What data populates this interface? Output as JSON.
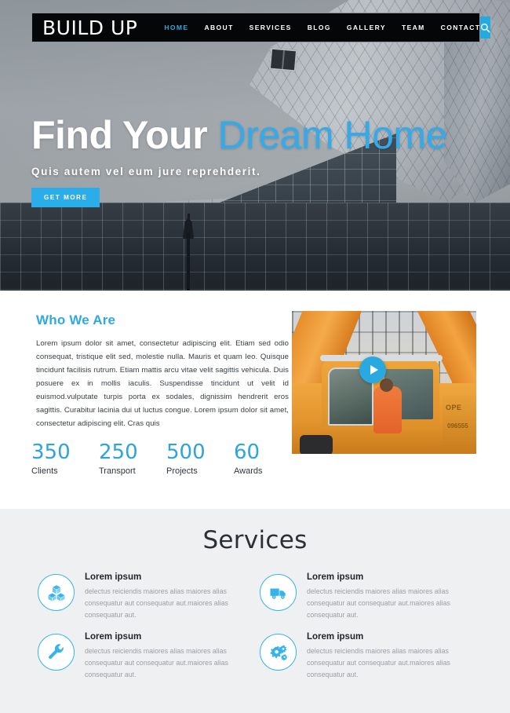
{
  "site": {
    "logo": "BUILD UP",
    "accent_color": "#2aa9e0",
    "nav_bg": "#050608"
  },
  "nav": {
    "items": [
      {
        "label": "HOME",
        "active": true
      },
      {
        "label": "ABOUT",
        "active": false
      },
      {
        "label": "SERVICES",
        "active": false
      },
      {
        "label": "BLOG",
        "active": false
      },
      {
        "label": "GALLERY",
        "active": false
      },
      {
        "label": "TEAM",
        "active": false
      },
      {
        "label": "CONTACT",
        "active": false
      }
    ],
    "search_icon": "search-icon"
  },
  "hero": {
    "title_plain": "Find Your ",
    "title_accent": "Dream Home",
    "subtitle": "Quis autem vel eum jure reprehderit.",
    "cta_label": "GET MORE",
    "background_description": "modern angular glass building with street lamp"
  },
  "about": {
    "heading": "Who We Are",
    "body": "Lorem ipsum dolor sit amet, consectetur adipiscing elit. Etiam sed odio consequat, tristique elit sed, molestie nulla. Mauris et quam leo. Quisque tincidunt facilisis rutrum. Etiam mattis arcu vitae velit sagittis vehicula. Duis posuere ex in mollis iaculis. Suspendisse tincidunt ut velit id euismod.vulputate turpis porta ex sodales, dignissim hendrerit eros sagittis. Curabitur lacinia dui ut luctus congue. Lorem ipsum dolor sit amet, consectetur adipiscing elit. Cras quis",
    "media": {
      "type": "video-thumbnail",
      "description": "yellow construction crane cab with operator",
      "play_icon": "play-icon",
      "overlay_text_1": "OPE",
      "overlay_text_2": "096555"
    },
    "stats": [
      {
        "value": "350",
        "label": "Clients"
      },
      {
        "value": "250",
        "label": "Transport"
      },
      {
        "value": "500",
        "label": "Projects"
      },
      {
        "value": "60",
        "label": "Awards"
      }
    ]
  },
  "services": {
    "heading": "Services",
    "items": [
      {
        "icon": "boxes-icon",
        "title": "Lorem ipsum",
        "desc": "delectus reiciendis maiores alias maiores alias consequatur aut consequatur aut.maiores alias consequatur aut."
      },
      {
        "icon": "truck-icon",
        "title": "Lorem ipsum",
        "desc": "delectus reiciendis maiores alias maiores alias consequatur aut consequatur aut.maiores alias consequatur aut."
      },
      {
        "icon": "wrench-icon",
        "title": "Lorem ipsum",
        "desc": "delectus reiciendis maiores alias maiores alias consequatur aut consequatur aut.maiores alias consequatur aut."
      },
      {
        "icon": "gears-icon",
        "title": "Lorem ipsum",
        "desc": "delectus reiciendis maiores alias maiores alias consequatur aut consequatur aut.maiores alias consequatur aut."
      }
    ]
  }
}
